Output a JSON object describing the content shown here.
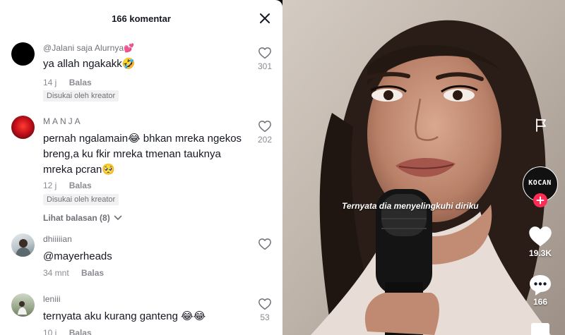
{
  "comments_panel": {
    "title": "166 komentar",
    "comments": [
      {
        "username": "@Jalani saja Alurnya💕",
        "text": "ya allah ngakakk🤣",
        "time": "14 j",
        "reply_label": "Balas",
        "creator_badge": "Disukai oleh kreator",
        "likes": "301"
      },
      {
        "username": "MANJA",
        "text_line1": "pernah ngalamain😂 bhkan mreka ngekos",
        "text_line2": "breng,a ku fkir mreka tmenan tauknya",
        "text_line3": "mreka pcran🥺",
        "time": "12 j",
        "reply_label": "Balas",
        "creator_badge": "Disukai oleh kreator",
        "view_replies": "Lihat balasan (8)",
        "likes": "202"
      },
      {
        "username": "dhiiiiian",
        "text": "@mayerheads",
        "time": "34 mnt",
        "reply_label": "Balas",
        "likes": ""
      },
      {
        "username": "leniii",
        "text": "ternyata aku kurang ganteng 😂😂",
        "time": "10 j",
        "reply_label": "Balas",
        "likes": "53"
      }
    ]
  },
  "video": {
    "caption": "Ternyata dia menyelingkuhi diriku",
    "creator_avatar_label": "KOCAN",
    "likes_count": "19.3K",
    "comments_count": "166"
  },
  "colors": {
    "accent": "#fe2c55",
    "text_primary": "#161823",
    "text_secondary": "#8a8b91"
  }
}
